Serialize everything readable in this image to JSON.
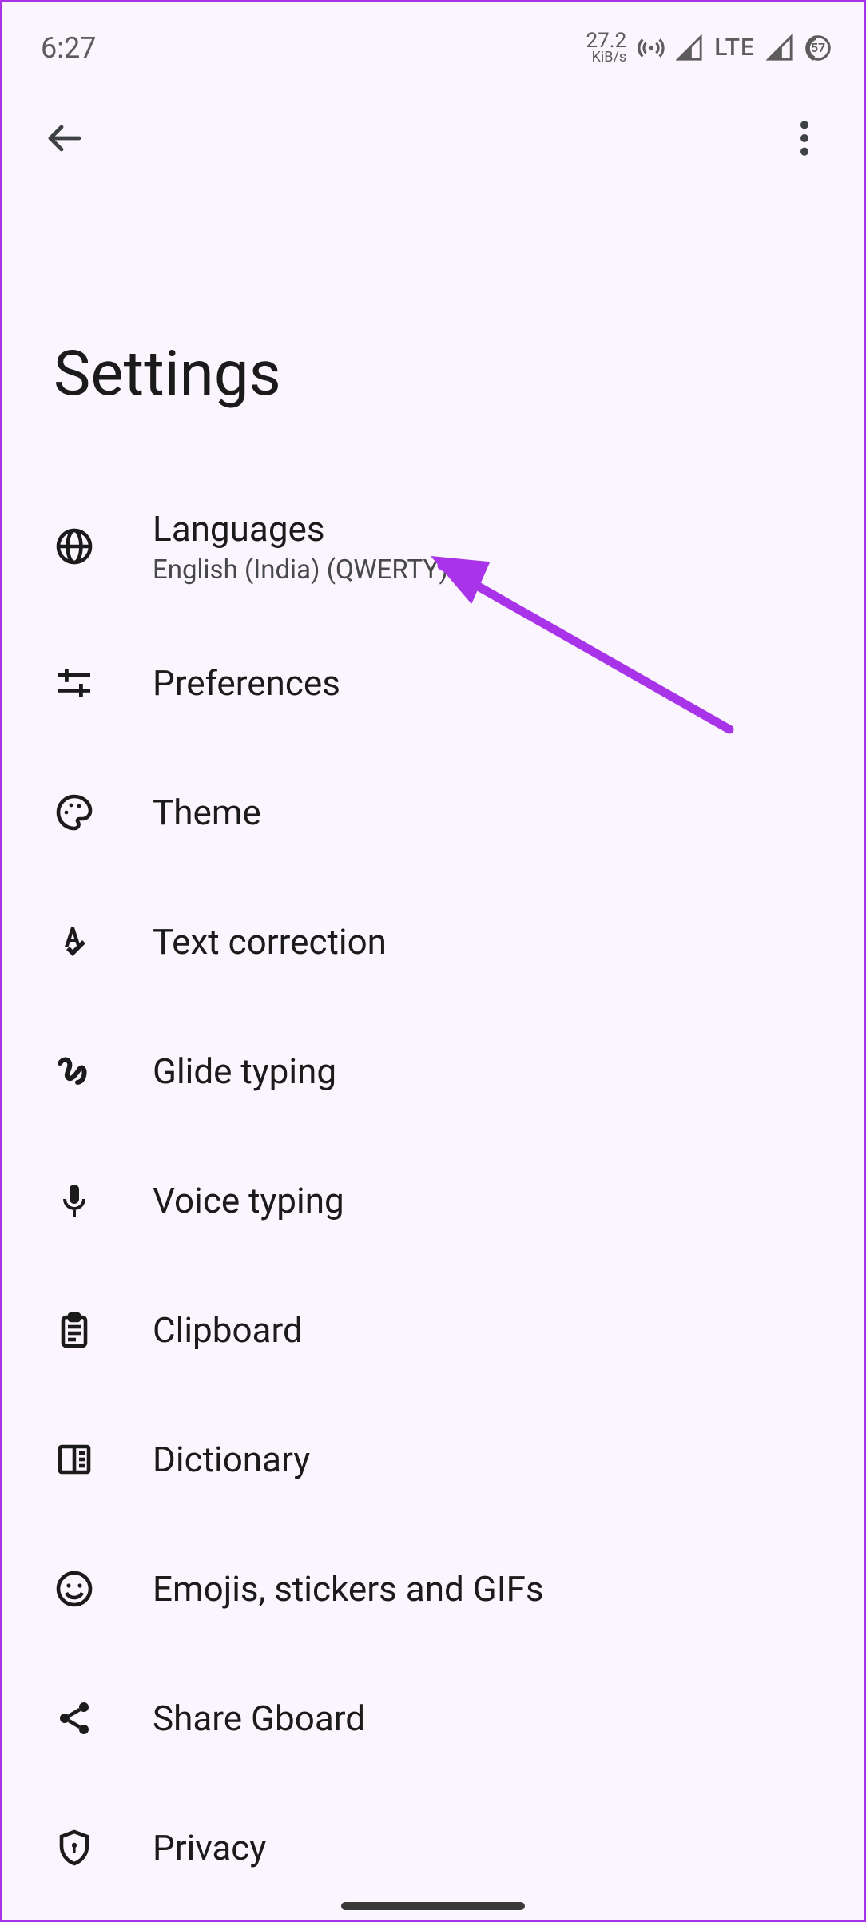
{
  "status": {
    "time": "6:27",
    "net_top": "27.2",
    "net_bot": "KiB/s",
    "network_type": "LTE",
    "battery": "57"
  },
  "page": {
    "title": "Settings"
  },
  "items": [
    {
      "label": "Languages",
      "sub": "English (India) (QWERTY)",
      "icon": "globe-icon"
    },
    {
      "label": "Preferences",
      "sub": "",
      "icon": "tune-icon"
    },
    {
      "label": "Theme",
      "sub": "",
      "icon": "palette-icon"
    },
    {
      "label": "Text correction",
      "sub": "",
      "icon": "spellcheck-icon"
    },
    {
      "label": "Glide typing",
      "sub": "",
      "icon": "gesture-icon"
    },
    {
      "label": "Voice typing",
      "sub": "",
      "icon": "mic-icon"
    },
    {
      "label": "Clipboard",
      "sub": "",
      "icon": "clipboard-icon"
    },
    {
      "label": "Dictionary",
      "sub": "",
      "icon": "book-icon"
    },
    {
      "label": "Emojis, stickers and GIFs",
      "sub": "",
      "icon": "emoji-icon"
    },
    {
      "label": "Share Gboard",
      "sub": "",
      "icon": "share-icon"
    },
    {
      "label": "Privacy",
      "sub": "",
      "icon": "privacy-icon"
    }
  ],
  "annotation": {
    "color": "#a933e8"
  }
}
